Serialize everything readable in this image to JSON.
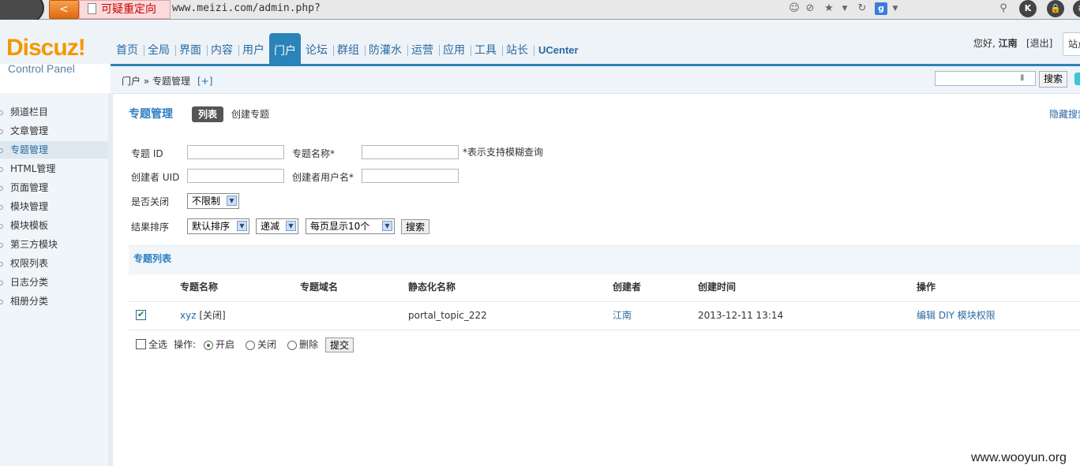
{
  "browser": {
    "back_label": "<",
    "redirect_warning": "可疑重定向",
    "url": "www.meizi.com/admin.php?",
    "search_engine_label": "g",
    "right_buttons": [
      "K",
      "🔒"
    ]
  },
  "header": {
    "logo": "Discuz!",
    "logo_sub": "Control Panel",
    "nav": [
      "首页",
      "全局",
      "界面",
      "内容",
      "用户",
      "门户",
      "论坛",
      "群组",
      "防灌水",
      "运营",
      "应用",
      "工具",
      "站长",
      "UCenter"
    ],
    "active_nav": "门户",
    "greeting_prefix": "您好,",
    "username": "江南",
    "logout": "[退出]",
    "site_label": "站点"
  },
  "breadcrumb": {
    "path": "门户 » 专题管理",
    "add": "[+]"
  },
  "header_search": {
    "button": "搜索"
  },
  "sidebar": {
    "items": [
      "频道栏目",
      "文章管理",
      "专题管理",
      "HTML管理",
      "页面管理",
      "模块管理",
      "模块模板",
      "第三方模块",
      "权限列表",
      "日志分类",
      "相册分类"
    ],
    "active": "专题管理"
  },
  "main": {
    "title": "专题管理",
    "tab_list": "列表",
    "tab_create": "创建专题",
    "hide_search": "隐藏搜索"
  },
  "filters": {
    "topic_id_label": "专题 ID",
    "topic_name_label": "专题名称*",
    "fuzzy_note": "*表示支持模糊查询",
    "creator_uid_label": "创建者 UID",
    "creator_name_label": "创建者用户名*",
    "closed_label": "是否关闭",
    "closed_value": "不限制",
    "sort_label": "结果排序",
    "sort_value": "默认排序",
    "order_value": "递减",
    "perpage_value": "每页显示10个",
    "search_button": "搜索"
  },
  "list": {
    "title": "专题列表",
    "columns": [
      "专题名称",
      "专题域名",
      "静态化名称",
      "创建者",
      "创建时间",
      "操作"
    ],
    "rows": [
      {
        "checked": true,
        "name": "xyz",
        "status": "[关闭]",
        "domain": "",
        "static_name": "portal_topic_222",
        "creator": "江南",
        "created": "2013-12-11 13:14",
        "ops": [
          "编辑",
          "DIY",
          "模块权限"
        ]
      }
    ]
  },
  "batch": {
    "select_all": "全选",
    "op_label": "操作:",
    "options": [
      "开启",
      "关闭",
      "删除"
    ],
    "selected": "开启",
    "submit": "提交"
  },
  "watermark": "www.wooyun.org"
}
